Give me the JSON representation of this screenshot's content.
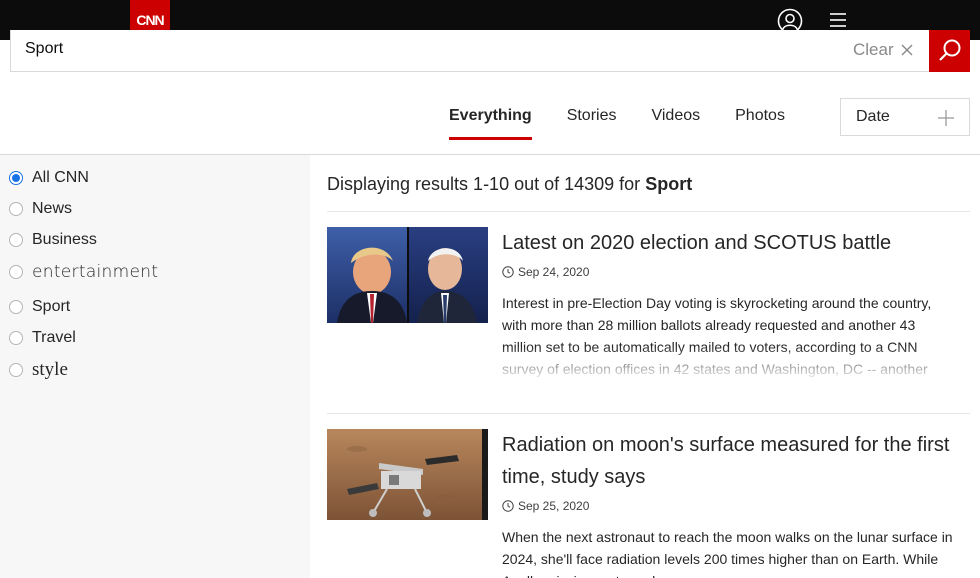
{
  "header": {
    "logo_text": "CNN",
    "brand_color": "#cc0000",
    "user_icon": "user-account-icon",
    "menu_icon": "hamburger-menu-icon"
  },
  "search": {
    "query": "Sport",
    "clear_label": "Clear"
  },
  "tabs": [
    {
      "label": "Everything",
      "active": true
    },
    {
      "label": "Stories",
      "active": false
    },
    {
      "label": "Videos",
      "active": false
    },
    {
      "label": "Photos",
      "active": false
    }
  ],
  "date_filter": {
    "label": "Date"
  },
  "filters": [
    {
      "label": "All CNN",
      "checked": true
    },
    {
      "label": "News",
      "checked": false
    },
    {
      "label": "Business",
      "checked": false
    },
    {
      "label": "entertainment",
      "checked": false
    },
    {
      "label": "Sport",
      "checked": false
    },
    {
      "label": "Travel",
      "checked": false
    },
    {
      "label": "style",
      "checked": false
    }
  ],
  "results": {
    "summary_prefix": "Displaying results 1-10 out of 14309 for",
    "summary_query": "Sport",
    "articles": [
      {
        "title": "Latest on 2020 election and SCOTUS battle",
        "date": "Sep 24, 2020",
        "body": "Interest in pre-Election Day voting is skyrocketing around the country, with more than 28 million ballots already requested and another 43 million set to be automatically mailed to voters, according to a CNN survey of election offices in 42 states and Washington, DC -- another"
      },
      {
        "title": "Radiation on moon's surface measured for the first time, study says",
        "date": "Sep 25, 2020",
        "body": "When the next astronaut to reach the moon walks on the lunar surface in 2024, she'll face radiation levels 200 times higher than on Earth. While Apollo missions returned"
      }
    ]
  }
}
